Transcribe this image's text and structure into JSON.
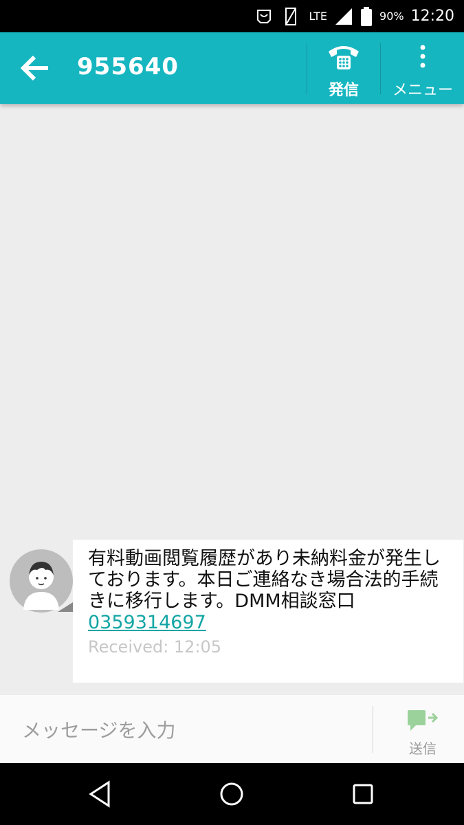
{
  "status_bar": {
    "network": "LTE",
    "battery": "90%",
    "time": "12:20"
  },
  "header": {
    "contact": "955640",
    "call_label": "発信",
    "menu_label": "メニュー"
  },
  "message": {
    "text": "有料動画閲覧履歴があり未納料金が発生しております。本日ご連絡なき場合法的手続きに移行します。DMM相談窓口",
    "phone": "0359314697",
    "status": "Received: 12:05"
  },
  "composer": {
    "placeholder": "メッセージを入力",
    "send_label": "送信"
  },
  "colors": {
    "accent": "#16b6c0",
    "link": "#13a5a5",
    "send_icon": "#9bd19a"
  }
}
